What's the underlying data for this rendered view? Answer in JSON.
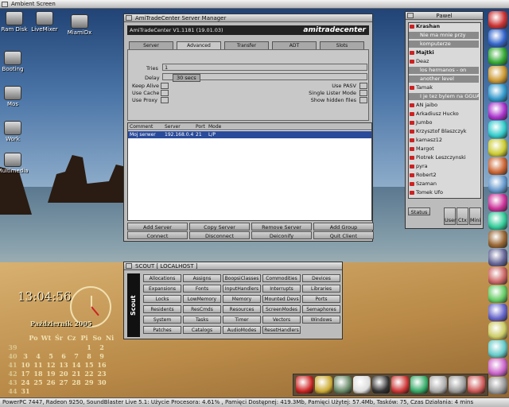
{
  "screen": {
    "title": "Ambient Screen"
  },
  "desktop_icons": [
    {
      "label": "Ram Disk",
      "icon": "ram-disk-icon"
    },
    {
      "label": "LiveMixer",
      "icon": "mixer-icon"
    },
    {
      "label": "MiamiDx",
      "icon": "miami-icon"
    },
    {
      "label": "Booting",
      "icon": "boot-icon"
    },
    {
      "label": "Mos",
      "icon": "drive-icon"
    },
    {
      "label": "Work",
      "icon": "drive-icon"
    },
    {
      "label": "Multimedia",
      "icon": "drive-icon"
    }
  ],
  "ftp": {
    "title": "AmiTradeCenter  Server Manager",
    "version": "AmiTradeCenter V1.1181 (19.01.03)",
    "logo": "amitradecenter",
    "tabs": [
      "Server",
      "Advanced",
      "Transfer",
      "ADT",
      "Slots"
    ],
    "active_tab": "Advanced",
    "tries_label": "Tries",
    "tries_value": "1",
    "delay_label": "Delay",
    "delay_value": "30 secs",
    "options_left": [
      "Keep Alive",
      "Use Cache",
      "Use Proxy"
    ],
    "options_right": [
      "Use PASV",
      "Single Lister Mode",
      "Show hidden files"
    ],
    "columns": [
      "Comment",
      "Server",
      "Port",
      "Mode"
    ],
    "rows": [
      {
        "comment": "Moj serwer",
        "server": "192.168.0.4",
        "port": "21",
        "mode": "L/P"
      }
    ],
    "buttons_row1": [
      "Add Server",
      "Copy Server",
      "Remove Server",
      "Add Group"
    ],
    "buttons_row2": [
      "Connect",
      "Disconnect",
      "Deiconify",
      "Quit Client"
    ]
  },
  "scout": {
    "title": "SCOUT  [ LOCALHOST ]",
    "side_label": "Scout",
    "buttons": [
      [
        "Allocations",
        "Assigns",
        "BoopsiClasses",
        "Commodities",
        "Devices"
      ],
      [
        "Expansions",
        "Fonts",
        "InputHandlers",
        "Interrupts",
        "Libraries"
      ],
      [
        "Locks",
        "LowMemory",
        "Memory",
        "Mounted Devs",
        "Ports"
      ],
      [
        "Residents",
        "ResCmds",
        "Resources",
        "ScreenModes",
        "Semaphores"
      ],
      [
        "System",
        "Tasks",
        "Timer",
        "Vectors",
        "Windows"
      ],
      [
        "Patches",
        "Catalogs",
        "AudioModes",
        "ResetHandlers"
      ]
    ]
  },
  "chat": {
    "title": "Pawel",
    "users": [
      {
        "name": "Krashan",
        "bold": true
      },
      {
        "name": "Nie ma mnie przy",
        "sub": true
      },
      {
        "name": "komputerze",
        "sub": true
      },
      {
        "name": "Majtki",
        "bold": true
      },
      {
        "name": "Deaz"
      },
      {
        "name": "los hermanos - on",
        "sub": true
      },
      {
        "name": "another level",
        "sub": true
      },
      {
        "name": "Tamak"
      },
      {
        "name": "I je tez bylem na GGUA",
        "sub": true
      },
      {
        "name": "AN jaibo"
      },
      {
        "name": "Arkadiusz Hucko"
      },
      {
        "name": "Jumbo"
      },
      {
        "name": "Krzysztof Blaszczyk"
      },
      {
        "name": "kamasz12"
      },
      {
        "name": "Margot"
      },
      {
        "name": "Piotrek Leszczynski"
      },
      {
        "name": "pyra"
      },
      {
        "name": "Robert2"
      },
      {
        "name": "Szaman"
      },
      {
        "name": "Tomek Ufo"
      }
    ],
    "status_label": "Status",
    "buttons": [
      "User",
      "Ctx",
      "Mini"
    ]
  },
  "clock": {
    "time": "13:04:56"
  },
  "calendar": {
    "month": "Październik  2005",
    "weekdays": [
      "Po",
      "Wt",
      "Śr",
      "Cz",
      "Pi",
      "So",
      "Ni"
    ],
    "weeks": [
      [
        "39",
        "",
        "",
        "",
        "",
        "",
        "1",
        "2"
      ],
      [
        "40",
        "3",
        "4",
        "5",
        "6",
        "7",
        "8",
        "9"
      ],
      [
        "41",
        "10",
        "11",
        "12",
        "13",
        "14",
        "15",
        "16"
      ],
      [
        "42",
        "17",
        "18",
        "19",
        "20",
        "21",
        "22",
        "23"
      ],
      [
        "43",
        "24",
        "25",
        "26",
        "27",
        "28",
        "29",
        "30"
      ],
      [
        "44",
        "31",
        "",
        "",
        "",
        "",
        "",
        ""
      ]
    ]
  },
  "statusbar": {
    "text": "PowerPC 7447, Radeon 9250, SoundBlaster Live 5.1:  Użycie Procesora: 4.61% , Pamięci Dostępnej: 419.3Mb, Pamięci Użytej: 57.4Mb, Tasków: 75, Czas Działania: 4 mins"
  }
}
